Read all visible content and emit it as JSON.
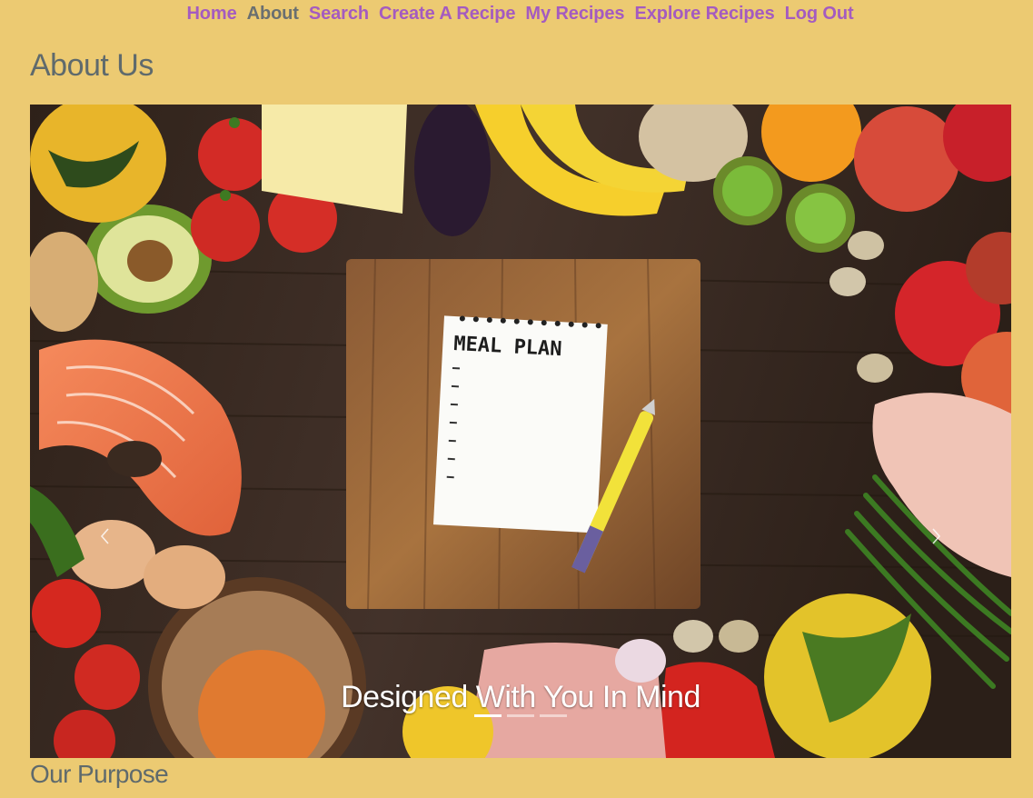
{
  "nav": {
    "items": [
      {
        "label": "Home"
      },
      {
        "label": "About"
      },
      {
        "label": "Search"
      },
      {
        "label": "Create A Recipe"
      },
      {
        "label": "My Recipes"
      },
      {
        "label": "Explore Recipes"
      },
      {
        "label": "Log Out"
      }
    ],
    "active_label": "About"
  },
  "page": {
    "title": "About Us",
    "section_title": "Our Purpose"
  },
  "carousel": {
    "caption": "Designed With You In Mind",
    "notepad_text": "MEAL PLAN",
    "slide_count": 3,
    "active_slide": 1,
    "prev_icon": "chevron-left-icon",
    "next_icon": "chevron-right-icon"
  },
  "colors": {
    "background": "#ecca72",
    "nav_link": "#a45bc0",
    "nav_active": "#6a6f70",
    "heading": "#5f6a6c"
  }
}
